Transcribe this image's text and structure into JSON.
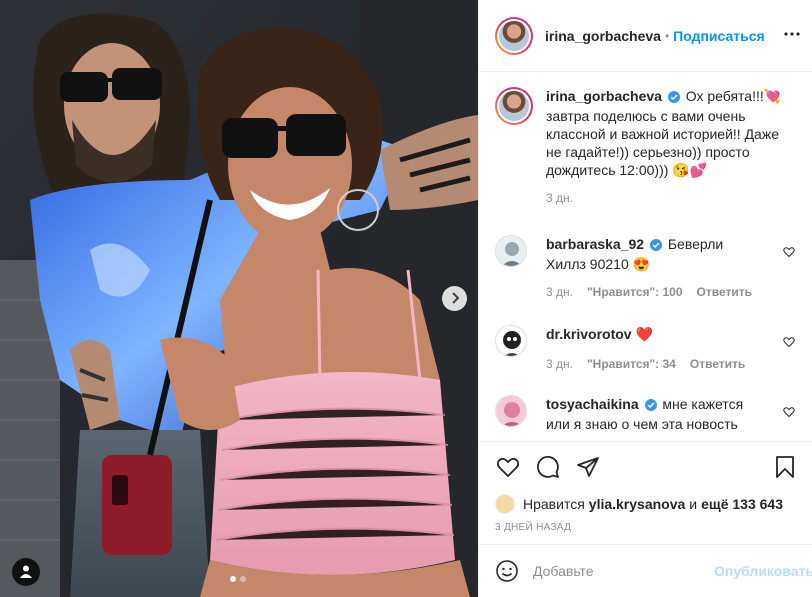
{
  "post": {
    "author": "irina_gorbacheva",
    "header_separator": "•",
    "follow_label": "Подписаться",
    "caption": {
      "username": "irina_gorbacheva",
      "text": "Ох ребята!!!💘 завтра поделюсь с вами очень классной и важной историей!! Даже не гадайте!)) серьезно)) просто дождитесь 12:00))) 😘💕",
      "time": "3 дн."
    },
    "comments": [
      {
        "username": "barbaraska_92",
        "verified": true,
        "text": "Беверли Хиллз 90210 😍",
        "time": "3 дн.",
        "likes": "\"Нравится\": 100",
        "reply": "Ответить"
      },
      {
        "username": "dr.krivorotov",
        "verified": false,
        "text": "❤️",
        "time": "3 дн.",
        "likes": "\"Нравится\": 34",
        "reply": "Ответить"
      },
      {
        "username": "tosyachaikina",
        "verified": true,
        "text": "мне кажется или я знаю о чем эта новость"
      }
    ],
    "likes_line": {
      "prefix": "Нравится",
      "user": "ylia.krysanova",
      "connector": "и",
      "rest": "ещё 133 643"
    },
    "date": "3 ДНЕЙ НАЗАД",
    "comment_placeholder": "Добавьте",
    "publish_label": "Опубликовать"
  },
  "colors": {
    "accent": "#0095f6",
    "verified": "#3897f0",
    "muted": "#8e8e8e",
    "publish_disabled": "#b2dffc"
  },
  "icons": [
    "verified-icon",
    "more-icon",
    "heart-icon",
    "comment-icon",
    "share-icon",
    "bookmark-icon",
    "emoji-icon",
    "chevron-right-icon",
    "user-tag-icon"
  ],
  "carousel": {
    "slides": 2,
    "current": 1
  }
}
